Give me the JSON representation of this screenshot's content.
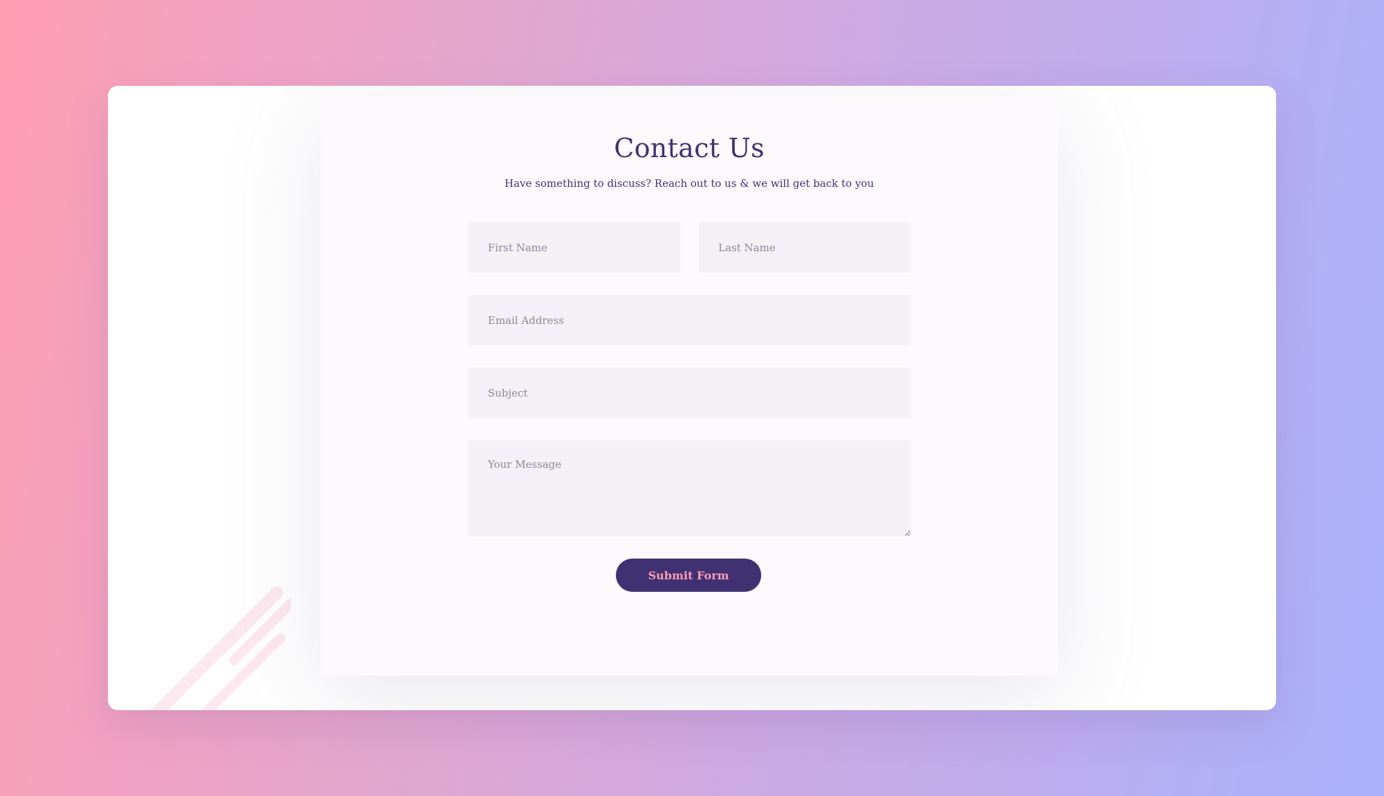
{
  "contact": {
    "title": "Contact Us",
    "subtitle": "Have something to discuss? Reach out to us & we will get back to you"
  },
  "form": {
    "first_name_placeholder": "First Name",
    "last_name_placeholder": "Last Name",
    "email_placeholder": "Email Address",
    "subject_placeholder": "Subject",
    "message_placeholder": "Your Message",
    "first_name_value": "",
    "last_name_value": "",
    "email_value": "",
    "subject_value": "",
    "message_value": "",
    "submit_label": "Submit Form"
  },
  "colors": {
    "brand_primary": "#403173",
    "accent_pink": "#ff9eb4",
    "field_background": "#f4f0f6",
    "panel_background": "#fef9fd",
    "gradient_start": "#ff9eb4",
    "gradient_end": "#a9b2fb"
  },
  "icons": {
    "decoration": "diagonal-stripes-decoration"
  }
}
